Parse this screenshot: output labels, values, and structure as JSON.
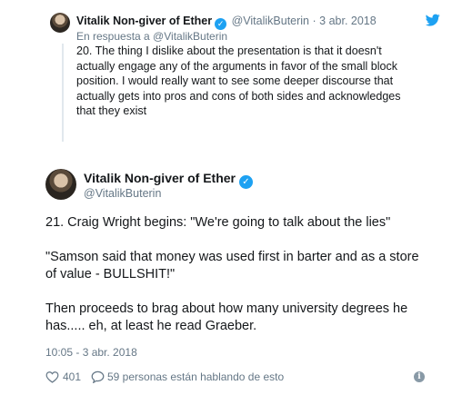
{
  "parent_tweet": {
    "author_name": "Vitalik Non-giver of Ether",
    "handle": "@VitalikButerin",
    "separator": "·",
    "date": "3 abr. 2018",
    "reply_to": "En respuesta a @VitalikButerin",
    "text_lines": [
      "20. The thing I dislike about the presentation is that it doesn't",
      "actually engage any of the arguments in favor of the small block",
      "position. I would really want to see some deeper discourse that",
      "actually gets into pros and cons of both sides and acknowledges",
      "that they exist"
    ]
  },
  "main_tweet": {
    "author_name": "Vitalik Non-giver of Ether",
    "handle": "@VitalikButerin",
    "paragraphs": [
      [
        "21. Craig Wright begins: \"We're going to talk about the lies\""
      ],
      [
        "\"Samson said that money was used first in barter and as a store",
        "of value - BULLSHIT!\""
      ],
      [
        "Then proceeds to brag about how many university degrees he",
        "has..... eh, at least he read Graeber."
      ]
    ],
    "timestamp": "10:05 - 3 abr. 2018",
    "like_count": "401",
    "replies_label": "59 personas están hablando de esto"
  },
  "icons": {
    "verified": "verified-badge-icon",
    "twitter": "twitter-bird-icon",
    "like": "heart-outline-icon",
    "reply": "speech-bubble-icon",
    "info": "info-icon"
  },
  "colors": {
    "twitter_blue": "#1da1f2",
    "secondary_text": "#657786",
    "primary_text": "#14171a",
    "thread_line": "#e1e8ed"
  }
}
